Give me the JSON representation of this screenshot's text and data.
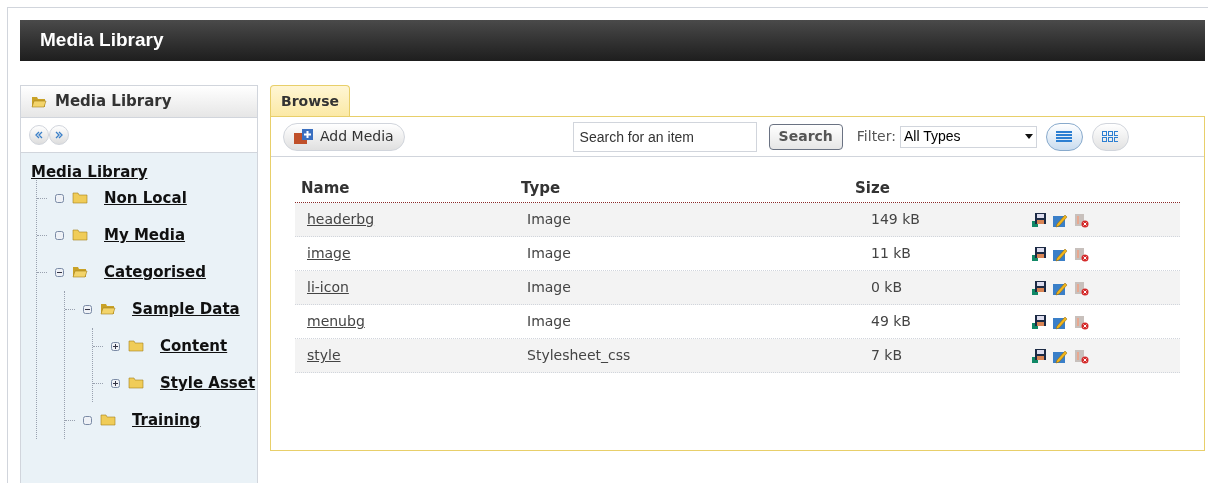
{
  "header": {
    "title": "Media Library"
  },
  "sidebar": {
    "title": "Media Library",
    "root": "Media Library",
    "tree": [
      {
        "label": "Non Local"
      },
      {
        "label": "My Media"
      },
      {
        "label": "Categorised",
        "expanded": true,
        "children": [
          {
            "label": "Sample Data",
            "expanded": true,
            "children": [
              {
                "label": "Content",
                "expanded": false
              },
              {
                "label": "Style Asset",
                "expanded": false
              }
            ]
          },
          {
            "label": "Training"
          }
        ]
      }
    ]
  },
  "tabs": [
    {
      "label": "Browse",
      "selected": true
    }
  ],
  "toolbar": {
    "add_button": "Add Media",
    "search": {
      "value": "Search for an item"
    },
    "search_button": "Search",
    "filter_label": "Filter:",
    "filter_value": "All Types",
    "views": [
      {
        "kind": "list",
        "selected": true
      },
      {
        "kind": "grid",
        "selected": false
      }
    ]
  },
  "table": {
    "columns": [
      "Name",
      "Type",
      "Size"
    ],
    "rows": [
      {
        "name": "headerbg",
        "type": "Image",
        "size": "149 kB"
      },
      {
        "name": "image",
        "type": "Image",
        "size": "11 kB"
      },
      {
        "name": "li-icon",
        "type": "Image",
        "size": "0 kB"
      },
      {
        "name": "menubg",
        "type": "Image",
        "size": "49 kB"
      },
      {
        "name": "style",
        "type": "Stylesheet_css",
        "size": "7 kB"
      }
    ]
  }
}
